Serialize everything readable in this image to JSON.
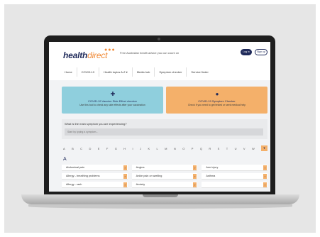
{
  "header": {
    "logo_main": "health",
    "logo_accent": "direct",
    "logo_dots": "●●●",
    "tagline": "Free Australian health advice you can count on",
    "login_label": "Log in",
    "signup_label": "Sign up"
  },
  "nav": {
    "items": [
      {
        "label": "Home"
      },
      {
        "label": "COVID-19"
      },
      {
        "label": "Health topics A-Z ▾"
      },
      {
        "label": "Media hub"
      },
      {
        "label": "Symptom checker"
      },
      {
        "label": "Service finder"
      }
    ]
  },
  "cards": [
    {
      "icon": "✚",
      "title": "COVID-19 Vaccine Side Effect checker",
      "subtitle": "Use this tool to check any side effects after your vaccination",
      "color": "#8fcfdd"
    },
    {
      "icon": "👤",
      "title": "COVID-19 Symptom Checker",
      "subtitle": "Check if you need to get tested or seek medical help",
      "color": "#f4b06a"
    }
  ],
  "search": {
    "question": "What is the main symptom you are experiencing?",
    "placeholder": "Start by typing a symptom..."
  },
  "alphabet": [
    "A",
    "B",
    "C",
    "D",
    "E",
    "F",
    "G",
    "H",
    "I",
    "J",
    "K",
    "L",
    "M",
    "N",
    "O",
    "P",
    "Q",
    "R",
    "S",
    "T",
    "U",
    "V",
    "W"
  ],
  "alphabet_button": "▼",
  "section_letter": "A",
  "symptoms": [
    [
      {
        "label": "Abdominal pain"
      },
      {
        "label": "Angina"
      },
      {
        "label": "Arm injury"
      }
    ],
    [
      {
        "label": "Allergy - breathing problems"
      },
      {
        "label": "Ankle pain or swelling"
      },
      {
        "label": "Asthma"
      }
    ],
    [
      {
        "label": "Allergy - rash"
      },
      {
        "label": "Anxiety"
      },
      {
        "label": ""
      }
    ]
  ],
  "colors": {
    "brand_navy": "#1f2a5a",
    "accent_orange": "#f4b06a",
    "accent_blue": "#8fcfdd"
  }
}
